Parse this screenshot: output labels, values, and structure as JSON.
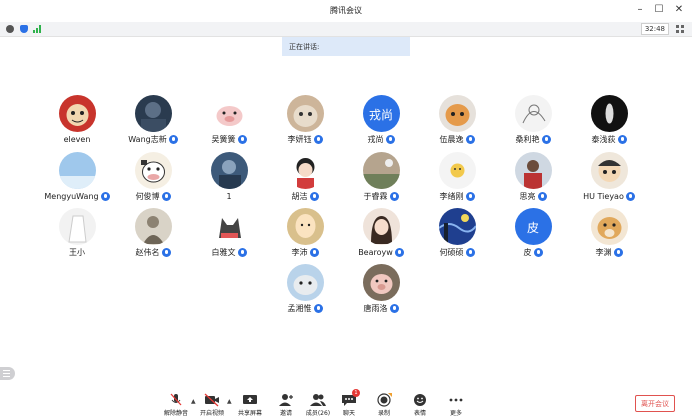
{
  "window": {
    "title": "腾讯会议"
  },
  "infobar": {
    "timer": "32:48"
  },
  "speaking": {
    "label": "正在讲话:"
  },
  "participants": [
    {
      "name": "eleven",
      "mic": false,
      "avatar": "cartoon-red"
    },
    {
      "name": "Wang志新",
      "mic": true,
      "avatar": "dark-photo"
    },
    {
      "name": "吴簧簧",
      "mic": true,
      "avatar": "pig"
    },
    {
      "name": "李妍钰",
      "mic": true,
      "avatar": "cat"
    },
    {
      "name": "戎尚",
      "mic": true,
      "avatar": "text",
      "avatar_text": "戎尚"
    },
    {
      "name": "伍晨逸",
      "mic": true,
      "avatar": "cat-orange"
    },
    {
      "name": "桑利艳",
      "mic": true,
      "avatar": "sketch"
    },
    {
      "name": "泰浅荻",
      "mic": true,
      "avatar": "dark-circle"
    },
    {
      "name": "MengyuWang",
      "mic": true,
      "avatar": "sky"
    },
    {
      "name": "何俊博",
      "mic": true,
      "avatar": "cow"
    },
    {
      "name": "1",
      "mic": false,
      "avatar": "blue-photo"
    },
    {
      "name": "胡洁",
      "mic": true,
      "avatar": "girl-cartoon"
    },
    {
      "name": "于睿霖",
      "mic": true,
      "avatar": "landscape"
    },
    {
      "name": "李绪刚",
      "mic": true,
      "avatar": "sun"
    },
    {
      "name": "思亮",
      "mic": true,
      "avatar": "person"
    },
    {
      "name": "HU Tieyao",
      "mic": true,
      "avatar": "anime"
    },
    {
      "name": "王小",
      "mic": false,
      "avatar": "white-figure"
    },
    {
      "name": "赵伟名",
      "mic": true,
      "avatar": "sketch-figure"
    },
    {
      "name": "白雅文",
      "mic": true,
      "avatar": "grey-cat"
    },
    {
      "name": "李沛",
      "mic": true,
      "avatar": "saitama"
    },
    {
      "name": "Bearoyw",
      "mic": true,
      "avatar": "girl-photo"
    },
    {
      "name": "何硕硕",
      "mic": true,
      "avatar": "starry-night"
    },
    {
      "name": "皮",
      "mic": true,
      "avatar": "text",
      "avatar_text": "皮"
    },
    {
      "name": "李渊",
      "mic": true,
      "avatar": "dog"
    },
    {
      "name": "孟湘惟",
      "mic": true,
      "avatar": "seal"
    },
    {
      "name": "唐雨洛",
      "mic": true,
      "avatar": "pig-photo"
    }
  ],
  "toolbar": {
    "mute": "解除静音",
    "video": "开启视频",
    "share": "共享屏幕",
    "invite": "邀请",
    "members": "成员(26)",
    "chat": "聊天",
    "chat_badge": "1",
    "record": "录制",
    "emoji": "表情",
    "more": "更多",
    "leave": "离开会议"
  },
  "icons": {
    "info": "info-icon",
    "shield": "shield-icon",
    "signal": "signal-icon",
    "grid": "grid-view-icon"
  },
  "colors": {
    "accent": "#2b71e6",
    "leave": "#e0524f",
    "speaking_bg": "#dde9f9"
  }
}
